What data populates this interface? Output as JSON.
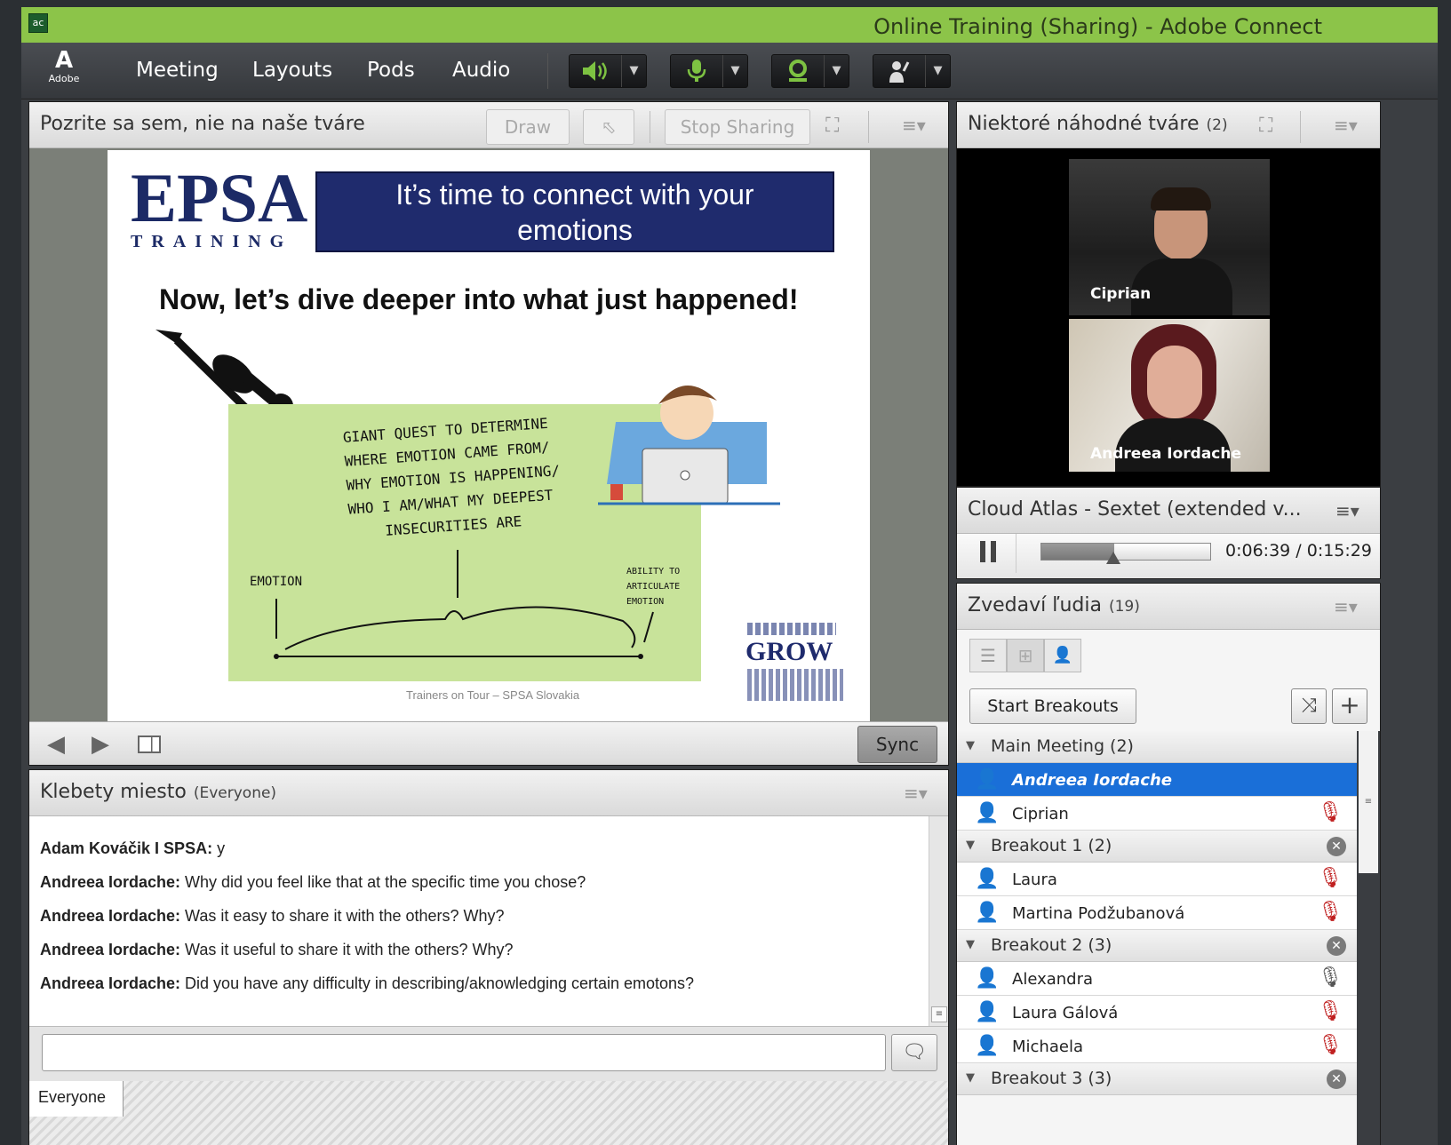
{
  "window": {
    "title": "Online Training (Sharing) - Adobe Connect",
    "app_icon": "adobe-connect-icon"
  },
  "menubar": {
    "logo_text": "Adobe",
    "menus": [
      "Meeting",
      "Layouts",
      "Pods",
      "Audio"
    ],
    "icons": [
      "speaker-icon",
      "microphone-icon",
      "webcam-icon",
      "raise-hand-icon"
    ],
    "accent_color": "#7dc242"
  },
  "share_pod": {
    "title": "Pozrite sa sem, nie na naše tváre",
    "draw_label": "Draw",
    "stop_sharing_label": "Stop Sharing",
    "sync_label": "Sync"
  },
  "slide": {
    "logo_main": "EPSA",
    "logo_sub": "TRAINING",
    "banner": "It’s time to connect with your emotions",
    "heading": "Now, let’s dive deeper into what just happened!",
    "handwriting": [
      "GIANT QUEST TO DETERMINE",
      "WHERE EMOTION CAME FROM/",
      "WHY EMOTION IS HAPPENING/",
      "WHO I AM/WHAT MY DEEPEST",
      "INSECURITIES ARE"
    ],
    "emotion_label": "EMOTION",
    "ability_label": [
      "ABILITY TO",
      "ARTICULATE",
      "EMOTION"
    ],
    "grow_word": "GROW",
    "footer": "Trainers on Tour – SPSA Slovakia"
  },
  "video_pod": {
    "title": "Niektoré náhodné tváre",
    "count": "(2)",
    "participants": [
      "Ciprian",
      "Andreea Iordache"
    ]
  },
  "music_pod": {
    "title": "Cloud Atlas - Sextet (extended v...",
    "time": "0:06:39 / 0:15:29",
    "progress": 0.43
  },
  "attendees_pod": {
    "title": "Zvedaví ľudia",
    "count": "(19)",
    "start_breakouts_label": "Start Breakouts",
    "groups": [
      {
        "name": "Main Meeting (2)",
        "members": [
          "Andreea Iordache",
          "Ciprian"
        ]
      },
      {
        "name": "Breakout 1 (2)",
        "members": [
          "Laura",
          "Martina Podžubanová"
        ]
      },
      {
        "name": "Breakout 2 (3)",
        "members": [
          "Alexandra",
          "Laura Gálová",
          "Michaela"
        ]
      },
      {
        "name": "Breakout 3 (3)",
        "members": []
      }
    ]
  },
  "chat_pod": {
    "title": "Klebety miesto",
    "scope": "(Everyone)",
    "messages": [
      {
        "sender": "Adam Kováčik I SPSA:",
        "text": " y"
      },
      {
        "sender": "Andreea Iordache:",
        "text": " Why did you feel like that at the specific time you chose?"
      },
      {
        "sender": "Andreea Iordache:",
        "text": " Was it easy to share it with the others? Why?"
      },
      {
        "sender": "Andreea Iordache:",
        "text": " Was it useful to share it with the others? Why?"
      },
      {
        "sender": "Andreea Iordache:",
        "text": " Did you have any difficulty in describing/aknowledging certain emotons?"
      }
    ],
    "input_value": "",
    "tab_label": "Everyone"
  }
}
